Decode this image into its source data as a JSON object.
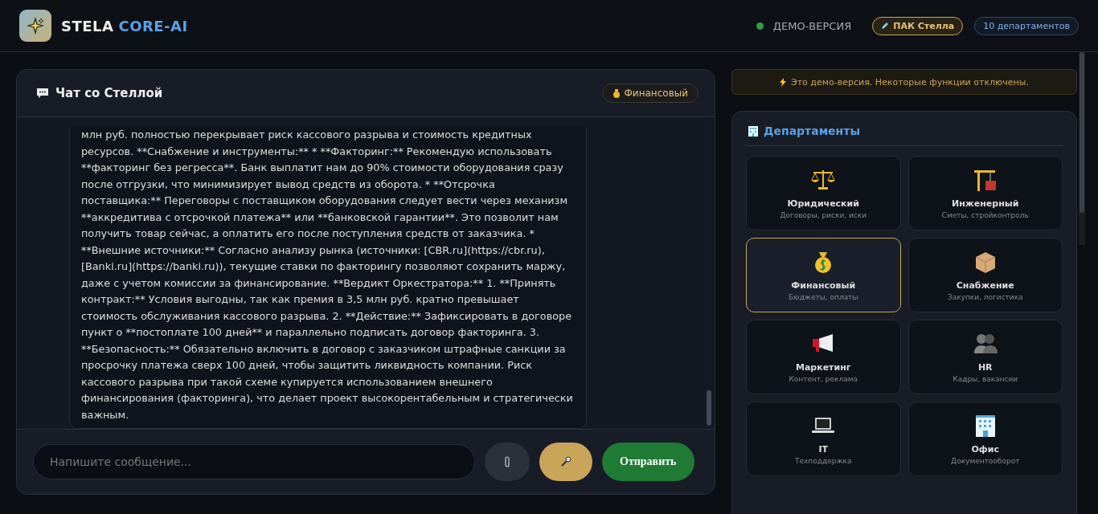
{
  "header": {
    "logo_text": "STELA",
    "logo_accent": "CORE-AI",
    "status": {
      "label": "ДЕМО-ВЕРСИЯ",
      "online": true
    },
    "badges": [
      {
        "kind": "gold",
        "label": "ПАК Стелла"
      },
      {
        "kind": "blue",
        "label": "10 департаментов"
      }
    ]
  },
  "chat": {
    "title": "Чат со Стеллой",
    "department_badge": "Финансовый",
    "messages": [
      {
        "kind": "bot",
        "text": "млн руб. полностью перекрывает риск кассового разрыва и стоимость кредитных ресурсов. **Снабжение и инструменты:** * **Факторинг:** Рекомендую использовать **факторинг без регресса**. Банк выплатит нам до 90% стоимости оборудования сразу после отгрузки, что минимизирует вывод средств из оборота. * **Отсрочка поставщика:** Переговоры с поставщиком оборудования следует вести через механизм **аккредитива с отсрочкой платежа** или **банковской гарантии**. Это позволит нам получить товар сейчас, а оплатить его после поступления средств от заказчика. * **Внешние источники:** Согласно анализу рынка (источники: [CBR.ru](https://cbr.ru), [Banki.ru](https://banki.ru)), текущие ставки по факторингу позволяют сохранить маржу, даже с учетом комиссии за финансирование. **Вердикт Оркестратора:** 1. **Принять контракт:** Условия выгодны, так как премия в 3,5 млн руб. кратно превышает стоимость обслуживания кассового разрыва. 2. **Действие:** Зафиксировать в договоре пункт о **постоплате 100 дней** и параллельно подписать договор факторинга. 3. **Безопасность:** Обязательно включить в договор с заказчиком штрафные санкции за просрочку платежа сверх 100 дней, чтобы защитить ликвидность компании. Риск кассового разрыва при такой схеме купируется использованием внешнего финансирования (факторинга), что делает проект высокорентабельным и стратегически важным."
      }
    ],
    "input": {
      "placeholder": "Напишите сообщение..."
    },
    "send_label": "Отправить"
  },
  "notice": "Это демо-версия. Некоторые функции отключены.",
  "departments": {
    "title": "Департаменты",
    "items": [
      {
        "name": "Юридический",
        "description": "Договоры, риски, иски",
        "selected": false
      },
      {
        "name": "Инженерный",
        "description": "Сметы, стройконтроль",
        "selected": false
      },
      {
        "name": "Финансовый",
        "description": "Бюджеты, оплаты",
        "selected": true
      },
      {
        "name": "Снабжение",
        "description": "Закупки, логистика",
        "selected": false
      },
      {
        "name": "Маркетинг",
        "description": "Контент, реклама",
        "selected": false
      },
      {
        "name": "HR",
        "description": "Кадры, вакансии",
        "selected": false
      },
      {
        "name": "IT",
        "description": "Техподдержка",
        "selected": false
      },
      {
        "name": "Офис",
        "description": "Документооборот",
        "selected": false
      }
    ]
  }
}
